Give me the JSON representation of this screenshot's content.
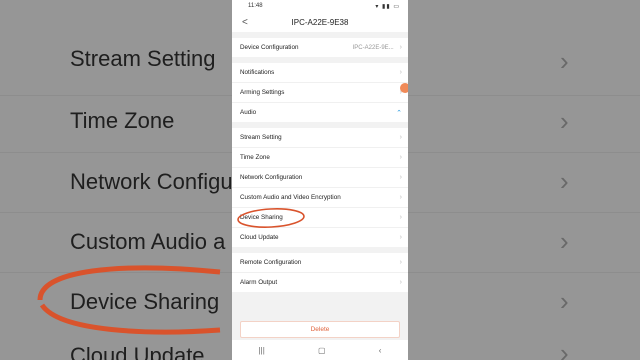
{
  "status_bar": {
    "time": "11:48"
  },
  "header": {
    "back_glyph": "<",
    "title": "IPC-A22E-9E38"
  },
  "groups": [
    {
      "items": [
        {
          "label": "Device Configuration",
          "value": "IPC-A22E-9E..."
        }
      ]
    },
    {
      "items": [
        {
          "label": "Notifications"
        },
        {
          "label": "Arming Settings"
        },
        {
          "label": "Audio"
        }
      ]
    },
    {
      "items": [
        {
          "label": "Stream Setting"
        },
        {
          "label": "Time Zone"
        },
        {
          "label": "Network Configuration"
        },
        {
          "label": "Custom Audio and Video Encryption"
        },
        {
          "label": "Device Sharing"
        },
        {
          "label": "Cloud Update"
        }
      ]
    },
    {
      "items": [
        {
          "label": "Remote Configuration"
        },
        {
          "label": "Alarm Output"
        }
      ]
    }
  ],
  "delete_label": "Delete",
  "background_zoom": {
    "left_rows": [
      "Stream Setting",
      "Time Zone",
      "Network Configu",
      "Custom Audio a",
      "Device Sharing",
      "Cloud Update"
    ]
  },
  "annotation_color": "#d9532c",
  "accent_color": "#2a9be0"
}
